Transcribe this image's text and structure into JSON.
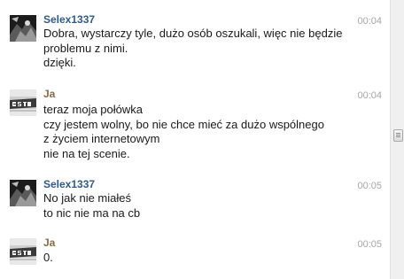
{
  "messages": [
    {
      "sender": "Selex1337",
      "time": "00:04",
      "avatar_icon": "dark-photo-avatar",
      "lines": "Dobra, wystarczy tyle, dużo osób oszukali, więc nie będzie\nproblemu z nimi.\ndzięki."
    },
    {
      "sender": "Ja",
      "time": "00:04",
      "avatar_icon": "ps-logo-avatar",
      "lines": "teraz moja połówka\nczy jestem wolny, bo nie chce mieć za dużo wspólnego\nz życiem internetowym\nnie na tej scenie."
    },
    {
      "sender": "Selex1337",
      "time": "00:05",
      "avatar_icon": "dark-photo-avatar",
      "lines": "No jak nie miałeś\nto nic nie ma na cb"
    },
    {
      "sender": "Ja",
      "time": "00:05",
      "avatar_icon": "ps-logo-avatar",
      "lines": "0."
    }
  ],
  "colors": {
    "selex_name": "#2f5a8a",
    "ja_name": "#8a6a45",
    "timestamp": "#a6a6a6",
    "text": "#1a1a1a"
  }
}
